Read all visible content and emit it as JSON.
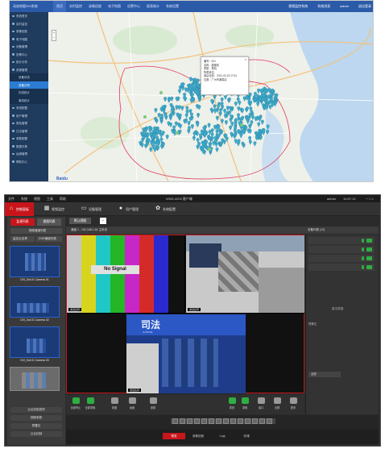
{
  "gis": {
    "brand": "动态地图GIS系统",
    "tabs": [
      "首页",
      "实时监控",
      "录像回放",
      "电子地图",
      "告警中心",
      "报表统计",
      "系统设置"
    ],
    "top_right": [
      "视频监控系统",
      "系统消息",
      "admin",
      "退出登录"
    ],
    "sidebar": [
      {
        "label": "系统首页",
        "sub": false,
        "active": false
      },
      {
        "label": "实时监控",
        "sub": false,
        "active": false
      },
      {
        "label": "录像回放",
        "sub": false,
        "active": false
      },
      {
        "label": "电子地图",
        "sub": false,
        "active": false
      },
      {
        "label": "设备管理",
        "sub": false,
        "active": false
      },
      {
        "label": "告警中心",
        "sub": false,
        "active": false
      },
      {
        "label": "统计分析",
        "sub": false,
        "active": false
      },
      {
        "label": "资源管理",
        "sub": false,
        "active": false
      },
      {
        "label": "设备状态",
        "sub": true,
        "active": false
      },
      {
        "label": "设备分布",
        "sub": true,
        "active": true
      },
      {
        "label": "在线统计",
        "sub": true,
        "active": false
      },
      {
        "label": "离线统计",
        "sub": true,
        "active": false
      },
      {
        "label": "系统配置",
        "sub": false,
        "active": false
      },
      {
        "label": "用户管理",
        "sub": false,
        "active": false
      },
      {
        "label": "角色管理",
        "sub": false,
        "active": false
      },
      {
        "label": "日志管理",
        "sub": false,
        "active": false
      },
      {
        "label": "参数配置",
        "sub": false,
        "active": false
      },
      {
        "label": "数据字典",
        "sub": false,
        "active": false
      },
      {
        "label": "运维管理",
        "sub": false,
        "active": false
      },
      {
        "label": "帮助中心",
        "sub": false,
        "active": false
      }
    ],
    "popup": {
      "lines": [
        "编号：001",
        "名称：摄像机",
        "类型：枪机",
        "所属单位：",
        "最后在线：2021-02-23 17:51",
        "位置：广州市番禺区"
      ]
    },
    "map_logo": "Baidu"
  },
  "vms": {
    "menu": [
      "文件",
      "系统",
      "视图",
      "工具",
      "帮助"
    ],
    "window_title": "iVMS-4200 客户端",
    "user": "admin",
    "time": "14:57:12",
    "nav": [
      {
        "label": "控制面板",
        "icon": "home",
        "active": true
      },
      {
        "label": "视频监控",
        "icon": "grid",
        "active": false
      },
      {
        "label": "设备管理",
        "icon": "camera",
        "active": false
      },
      {
        "label": "用户管理",
        "icon": "person",
        "active": false
      },
      {
        "label": "系统配置",
        "icon": "gear",
        "active": false
      }
    ],
    "left": {
      "tabs": [
        "监视列表",
        "视图列表"
      ],
      "group": "视频通道列表",
      "select_a": "监控点名称",
      "select_b": "DVR通道列表",
      "cameras": [
        "DVI_Dsf-01 Camera 01",
        "DVI_Dsf-01 Camera 02",
        "DVI_Dsf-01 Camera 03"
      ],
      "bottom": [
        "云台控制选项",
        "视频参数",
        "预置位",
        "云台控制"
      ]
    },
    "main": {
      "tab": "默认视图",
      "toolbar_text": "通道 1 - 192.168.1.64 主码流",
      "right_title": "设备列表 (12)",
      "grid_labels": [
        "通道名称",
        "通道名称",
        "通道名称"
      ],
      "nosignal": "No Signal",
      "sign_text": "司法",
      "sign_sub": "JUSTICE",
      "controls": [
        "全部停止",
        "全部录像",
        "抓图",
        "画面",
        "参数",
        "抓拍",
        "录像",
        "窗口",
        "全屏",
        "更多"
      ],
      "right_panel": {
        "empty": "暂无数据",
        "select": "全部",
        "label_a": "预置位"
      },
      "foot_tabs": [
        "预览",
        "录像回放",
        "Logi",
        "存储"
      ]
    }
  }
}
